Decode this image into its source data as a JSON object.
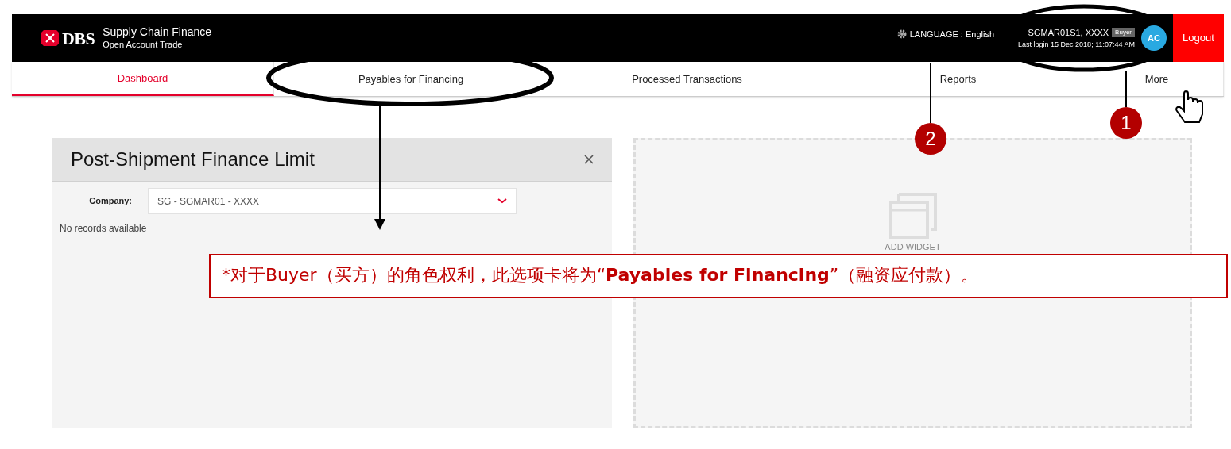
{
  "header": {
    "logo": "DBS",
    "product_title": "Supply Chain Finance",
    "product_subtitle": "Open Account Trade",
    "language": "LANGUAGE : English",
    "user_id": "SGMAR01S1, XXXX",
    "role_badge": "Buyer",
    "last_login": "Last login 15 Dec 2018; 11:07:44 AM",
    "avatar": "AC",
    "logout": "Logout"
  },
  "tabs": [
    {
      "label": "Dashboard",
      "selected": true
    },
    {
      "label": "Payables for Financing",
      "selected": false
    },
    {
      "label": "Processed Transactions",
      "selected": false
    },
    {
      "label": "Reports",
      "selected": false
    },
    {
      "label": "More",
      "selected": false
    }
  ],
  "widget": {
    "title": "Post-Shipment Finance Limit",
    "company_label": "Company:",
    "company_value": "SG - SGMAR01 - XXXX",
    "empty_message": "No records available"
  },
  "add_widget": {
    "label": "ADD WIDGET"
  },
  "annotations": {
    "callouts": [
      {
        "number": "1"
      },
      {
        "number": "2"
      }
    ],
    "note": "*对于Buyer（买方）的角色权利，此选项卡将为“**Payables for Financing**”（融资应付款）。"
  }
}
